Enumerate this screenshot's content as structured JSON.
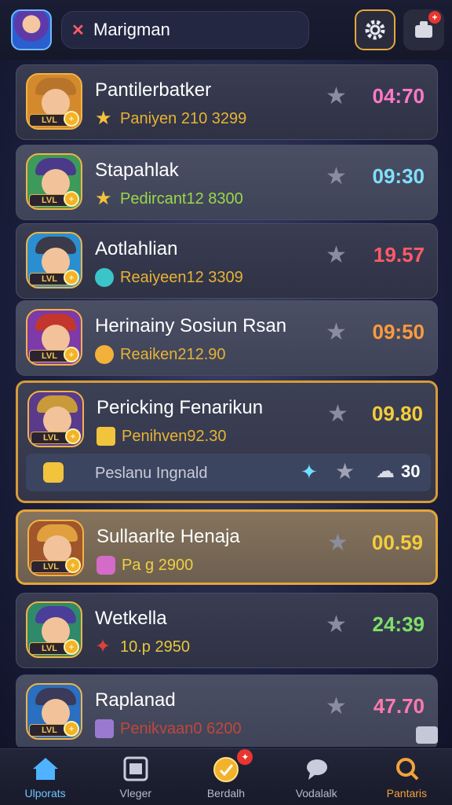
{
  "header": {
    "search_text": "Marigman",
    "notification_badge": "+"
  },
  "rows": [
    {
      "name": "Pantilerbatker",
      "sub": "Paniyen 210 3299",
      "time": "04:70",
      "time_color": "#ff79c8",
      "sub_color": "#e7b334",
      "extra_color": "#6fe07b"
    },
    {
      "name": "Stapahlak",
      "sub": "Pedircant12 8300",
      "time": "09:30",
      "time_color": "#7fe0ff",
      "sub_color": "#9ad84a"
    },
    {
      "name": "Aotlahlian",
      "sub": "Reaiyeen12 3309",
      "time": "19.57",
      "time_color": "#ff5a6a",
      "sub_color": "#e7b334"
    },
    {
      "name": "Herinainy Sosiun Rsan",
      "sub": "Reaiken212.90",
      "time": "09:50",
      "time_color": "#ff9a3c",
      "sub_color": "#e7b334"
    },
    {
      "name": "Pericking Fenarikun",
      "sub": "Penihven92.30",
      "time": "09.80",
      "time_color": "#f5cc3c",
      "sub_color": "#e7b334",
      "extra_text": "Peslanu Ingnald",
      "extra_count": "30"
    },
    {
      "name": "Sullaarlte Henaja",
      "sub": "Pa g 2900",
      "time": "00.59",
      "time_color": "#f5cc3c",
      "sub_color": "#f0d040"
    },
    {
      "name": "Wetkella",
      "sub": "10.p 2950",
      "time": "24:39",
      "time_color": "#7ee06a",
      "sub_color": "#e7c83c"
    },
    {
      "name": "Raplanad",
      "sub": "Penikvaan0 6200",
      "time": "47.70",
      "time_color": "#ff79b0",
      "sub_color": "#c0473a"
    }
  ],
  "nav": [
    {
      "label": "Ulporats"
    },
    {
      "label": "Vleger"
    },
    {
      "label": "Berdalh"
    },
    {
      "label": "Vodalalk"
    },
    {
      "label": "Pantaris"
    }
  ]
}
